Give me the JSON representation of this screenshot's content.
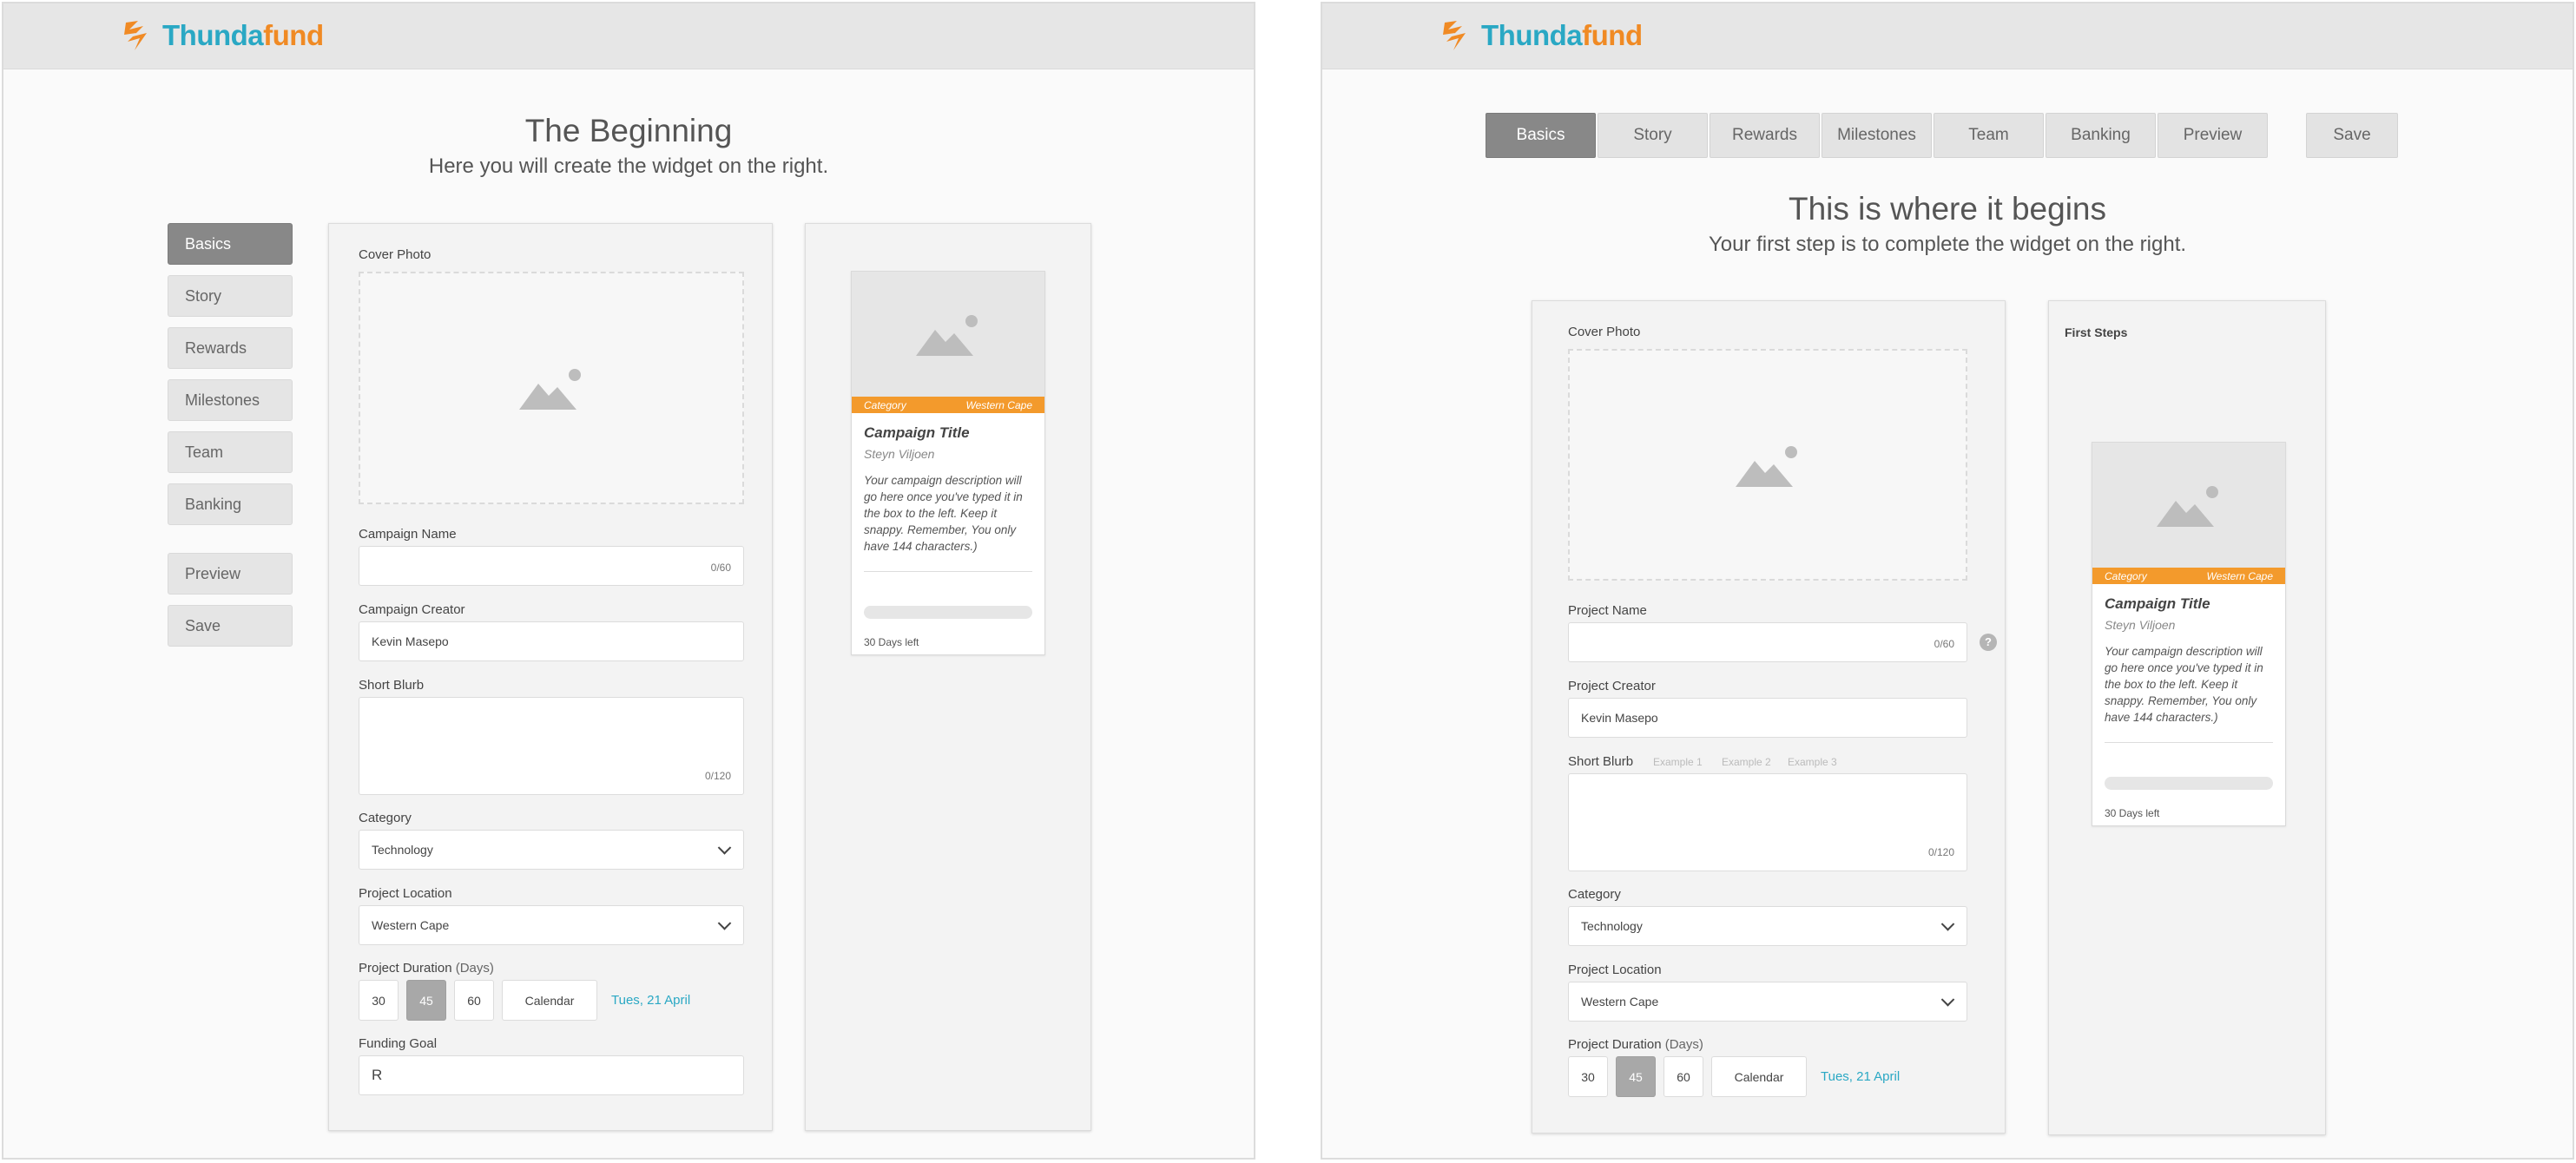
{
  "brand": {
    "part1": "Thunda",
    "part2": "fund"
  },
  "left": {
    "title": "The Beginning",
    "subtitle": "Here you will create the widget on the right.",
    "nav": [
      "Basics",
      "Story",
      "Rewards",
      "Milestones",
      "Team",
      "Banking",
      "Preview",
      "Save"
    ],
    "form": {
      "cover_photo": "Cover Photo",
      "campaign_name": "Campaign Name",
      "campaign_name_counter": "0/60",
      "campaign_creator": "Campaign Creator",
      "campaign_creator_value": "Kevin Masepo",
      "short_blurb": "Short Blurb",
      "short_blurb_counter": "0/120",
      "category": "Category",
      "category_value": "Technology",
      "project_location": "Project Location",
      "project_location_value": "Western Cape",
      "project_duration": "Project Duration",
      "duration_unit": "(Days)",
      "durations": [
        "30",
        "45",
        "60"
      ],
      "calendar": "Calendar",
      "end_date": "Tues, 21 April",
      "funding_goal": "Funding Goal",
      "funding_goal_value": "R"
    }
  },
  "right": {
    "tabs": [
      "Basics",
      "Story",
      "Rewards",
      "Milestones",
      "Team",
      "Banking",
      "Preview"
    ],
    "save": "Save",
    "title": "This is where it begins",
    "subtitle": "Your first step is to complete the widget on the right.",
    "form": {
      "cover_photo": "Cover Photo",
      "project_name": "Project Name",
      "project_name_counter": "0/60",
      "help": "?",
      "project_creator": "Project Creator",
      "project_creator_value": "Kevin Masepo",
      "short_blurb": "Short Blurb",
      "examples": [
        "Example 1",
        "Example 2",
        "Example 3"
      ],
      "short_blurb_counter": "0/120",
      "category": "Category",
      "category_value": "Technology",
      "project_location": "Project Location",
      "project_location_value": "Western Cape",
      "project_duration": "Project Duration",
      "duration_unit": "(Days)",
      "durations": [
        "30",
        "45",
        "60"
      ],
      "calendar": "Calendar",
      "end_date": "Tues, 21 April"
    },
    "first_steps": "First Steps"
  },
  "card": {
    "category": "Category",
    "location": "Western Cape",
    "title": "Campaign Title",
    "creator": "Steyn Viljoen",
    "description": "Your campaign description will go here once you've typed it in the box to the left. Keep it snappy. Remember, You only have 144 characters.)",
    "days_left": "30 Days left",
    "progress": 0
  },
  "colors": {
    "brand_blue": "#2aa8c4",
    "brand_orange": "#f08a24",
    "strip_orange": "#f39a2c",
    "active_gray": "#888888"
  }
}
